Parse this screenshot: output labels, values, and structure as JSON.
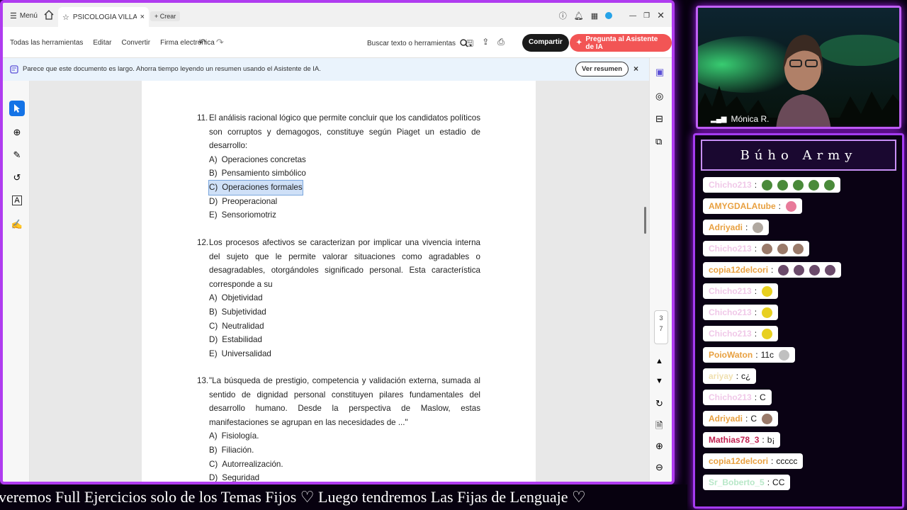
{
  "tabbar": {
    "menu_label": "Menú",
    "tab_title": "PSICOLOGÍA VILLAR...",
    "create_label": "Crear"
  },
  "toolbar": {
    "all_tools": "Todas las herramientas",
    "edit": "Editar",
    "convert": "Convertir",
    "esign": "Firma electrónica",
    "search_label": "Buscar texto o herramientas",
    "share": "Compartir",
    "ai_assistant": "Pregunta al Asistente de IA"
  },
  "banner": {
    "text": "Parece que este documento es largo. Ahorra tiempo leyendo un resumen usando el Asistente de IA.",
    "button": "Ver resumen",
    "close": "×"
  },
  "pagenum": {
    "current": "3",
    "total": "7"
  },
  "questions": [
    {
      "num": "11.",
      "stem": "El análisis racional lógico que permite concluir que los candidatos políticos son corruptos y demagogos, constituye según Piaget un estadio de desarrollo:",
      "options": [
        {
          "letter": "A)",
          "text": "Operaciones concretas"
        },
        {
          "letter": "B)",
          "text": "Pensamiento simbólico"
        },
        {
          "letter": "C)",
          "text": "Operaciones formales"
        },
        {
          "letter": "D)",
          "text": "Preoperacional"
        },
        {
          "letter": "E)",
          "text": "Sensoriomotriz"
        }
      ]
    },
    {
      "num": "12.",
      "stem": "Los procesos afectivos se caracterizan por implicar una vivencia interna del sujeto que le permite valorar situaciones como agradables o desagradables, otorgándoles significado personal. Esta característica corresponde a su",
      "options": [
        {
          "letter": "A)",
          "text": "Objetividad"
        },
        {
          "letter": "B)",
          "text": "Subjetividad"
        },
        {
          "letter": "C)",
          "text": "Neutralidad"
        },
        {
          "letter": "D)",
          "text": "Estabilidad"
        },
        {
          "letter": "E)",
          "text": "Universalidad"
        }
      ]
    },
    {
      "num": "13.",
      "stem": "\"La búsqueda de prestigio, competencia y validación externa, sumada al sentido de dignidad personal constituyen pilares fundamentales del desarrollo humano. Desde la perspectiva de Maslow, estas manifestaciones se agrupan en las necesidades de ...\"",
      "options": [
        {
          "letter": "A)",
          "text": "Fisiología."
        },
        {
          "letter": "B)",
          "text": "Filiación."
        },
        {
          "letter": "C)",
          "text": "Autorrealización."
        },
        {
          "letter": "D)",
          "text": "Seguridad"
        }
      ]
    }
  ],
  "webcam": {
    "name": "Mónica R."
  },
  "chat": {
    "title": "Búho Army",
    "messages": [
      {
        "user": "Chicho213",
        "color": "#f0c8e8",
        "text": "",
        "emotes": [
          "#4a8a3a",
          "#4a8a3a",
          "#4a8a3a",
          "#4a8a3a",
          "#4a8a3a"
        ]
      },
      {
        "user": "AMYGDALAtube",
        "color": "#e8a040",
        "text": "",
        "emotes": [
          "#e87a9a"
        ]
      },
      {
        "user": "Adriyadi",
        "color": "#e8a040",
        "text": "",
        "emotes": [
          "#b0a8a0"
        ]
      },
      {
        "user": "Chicho213",
        "color": "#f0c8e8",
        "text": "",
        "emotes": [
          "#9a7a6a",
          "#9a7a6a",
          "#9a7a6a"
        ]
      },
      {
        "user": "copia12delcori",
        "color": "#e8a040",
        "text": "",
        "emotes": [
          "#6a4a6a",
          "#6a4a6a",
          "#6a4a6a",
          "#6a4a6a"
        ]
      },
      {
        "user": "Chicho213",
        "color": "#f0c8e8",
        "text": "",
        "emotes": [
          "#e8d020"
        ]
      },
      {
        "user": "Chicho213",
        "color": "#f0c8e8",
        "text": "",
        "emotes": [
          "#e8d020"
        ]
      },
      {
        "user": "Chicho213",
        "color": "#f0c8e8",
        "text": "",
        "emotes": [
          "#e8d020"
        ]
      },
      {
        "user": "PoioWaton",
        "color": "#e8a040",
        "text": "11c",
        "emotes": [
          "#c0c0c0"
        ]
      },
      {
        "user": "ariyay",
        "color": "#f0e0b0",
        "text": "c¿",
        "emotes": []
      },
      {
        "user": "Chicho213",
        "color": "#f0c8e8",
        "text": "C",
        "emotes": []
      },
      {
        "user": "Adriyadi",
        "color": "#e8a040",
        "text": "C",
        "emotes": [
          "#9a7a6a"
        ]
      },
      {
        "user": "Mathias78_3",
        "color": "#c02050",
        "text": "b¡",
        "emotes": []
      },
      {
        "user": "copia12delcori",
        "color": "#e8a040",
        "text": "ccccc",
        "emotes": []
      },
      {
        "user": "Sr_Boberto_5",
        "color": "#b8e8c8",
        "text": "CC",
        "emotes": []
      }
    ]
  },
  "ticker": {
    "text": "veremos Full Ejercicios solo de los Temas Fijos   ♡   Luego tendremos Las Fijas de Lenguaje   ♡"
  }
}
